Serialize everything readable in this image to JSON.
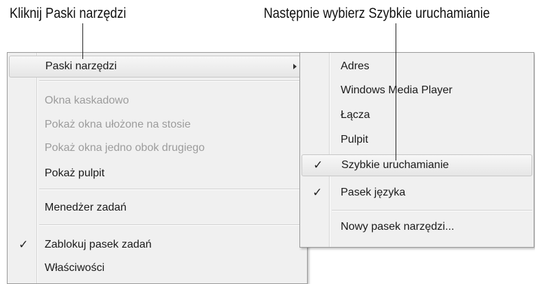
{
  "captions": {
    "left": "Kliknij Paski narzędzi",
    "right": "Następnie wybierz Szybkie uruchamianie"
  },
  "main_menu": {
    "toolbars": "Paski narzędzi",
    "cascade": "Okna kaskadowo",
    "stacked": "Pokaż okna ułożone na stosie",
    "side_by_side": "Pokaż okna jedno obok drugiego",
    "show_desktop": "Pokaż pulpit",
    "task_manager": "Menedżer zadań",
    "lock_taskbar": "Zablokuj pasek zadań",
    "properties": "Właściwości"
  },
  "submenu": {
    "address": "Adres",
    "media_player": "Windows Media Player",
    "links": "Łącza",
    "desktop": "Pulpit",
    "quick_launch": "Szybkie uruchamianie",
    "language_bar": "Pasek języka",
    "new_toolbar": "Nowy pasek narzędzi..."
  },
  "check_glyph": "✓",
  "checked": {
    "lock_taskbar": true,
    "quick_launch": true,
    "language_bar": true
  }
}
